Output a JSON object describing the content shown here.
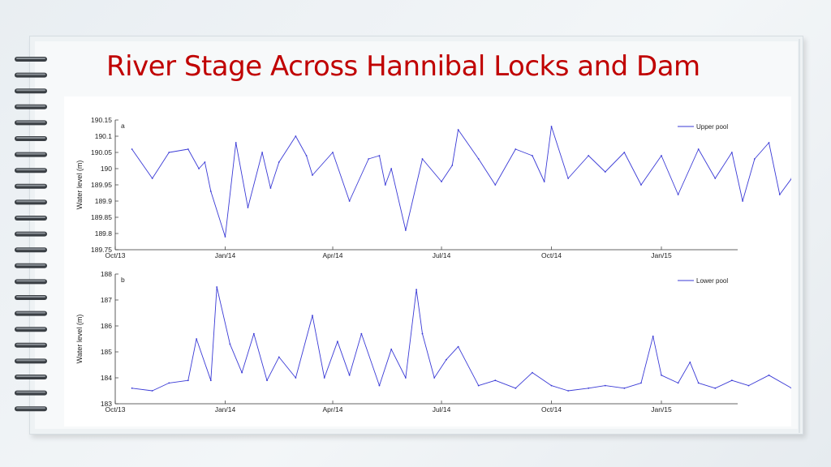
{
  "slide": {
    "title": "River Stage Across Hannibal Locks and Dam"
  },
  "colors": {
    "title": "#c00000",
    "series": "#3a3ad6",
    "axis": "#333333"
  },
  "chart_data": [
    {
      "type": "line",
      "panel_label": "a",
      "ylabel": "Water level (m)",
      "xlabel": "",
      "x_ticks": [
        "Oct/13",
        "Jan/14",
        "Apr/14",
        "Jul/14",
        "Oct/14",
        "Jan/15"
      ],
      "ylim": [
        189.75,
        190.15
      ],
      "y_ticks": [
        "189.75",
        "189.8",
        "189.85",
        "189.9",
        "189.95",
        "190",
        "190.05",
        "190.1",
        "190.15"
      ],
      "legend_position": "top-right",
      "grid": false,
      "series": [
        {
          "name": "Upper pool",
          "x": [
            "2013-10-15",
            "2013-11-01",
            "2013-11-15",
            "2013-12-01",
            "2013-12-10",
            "2013-12-15",
            "2013-12-20",
            "2014-01-01",
            "2014-01-10",
            "2014-01-20",
            "2014-02-01",
            "2014-02-08",
            "2014-02-15",
            "2014-03-01",
            "2014-03-10",
            "2014-03-15",
            "2014-04-01",
            "2014-04-15",
            "2014-05-01",
            "2014-05-10",
            "2014-05-15",
            "2014-05-20",
            "2014-06-01",
            "2014-06-15",
            "2014-07-01",
            "2014-07-10",
            "2014-07-15",
            "2014-08-01",
            "2014-08-15",
            "2014-09-01",
            "2014-09-15",
            "2014-09-25",
            "2014-10-01",
            "2014-10-15",
            "2014-11-01",
            "2014-11-15",
            "2014-12-01",
            "2014-12-15",
            "2015-01-01",
            "2015-01-15",
            "2015-02-01",
            "2015-02-15",
            "2015-03-01",
            "2015-03-10",
            "2015-03-20",
            "2015-04-01",
            "2015-04-10",
            "2015-04-20"
          ],
          "values": [
            190.06,
            189.97,
            190.05,
            190.06,
            190.0,
            190.02,
            189.93,
            189.79,
            190.08,
            189.88,
            190.05,
            189.94,
            190.02,
            190.1,
            190.04,
            189.98,
            190.05,
            189.9,
            190.03,
            190.04,
            189.95,
            190.0,
            189.81,
            190.03,
            189.96,
            190.01,
            190.12,
            190.03,
            189.95,
            190.06,
            190.04,
            189.96,
            190.13,
            189.97,
            190.04,
            189.99,
            190.05,
            189.95,
            190.04,
            189.92,
            190.06,
            189.97,
            190.05,
            189.9,
            190.03,
            190.08,
            189.92,
            189.97
          ]
        }
      ]
    },
    {
      "type": "line",
      "panel_label": "b",
      "ylabel": "Water level (m)",
      "xlabel": "",
      "x_ticks": [
        "Oct/13",
        "Jan/14",
        "Apr/14",
        "Jul/14",
        "Oct/14",
        "Jan/15"
      ],
      "ylim": [
        183,
        188
      ],
      "y_ticks": [
        "183",
        "184",
        "185",
        "186",
        "187",
        "188"
      ],
      "legend_position": "top-right",
      "grid": false,
      "series": [
        {
          "name": "Lower pool",
          "x": [
            "2013-10-15",
            "2013-11-01",
            "2013-11-15",
            "2013-12-01",
            "2013-12-08",
            "2013-12-20",
            "2013-12-25",
            "2014-01-05",
            "2014-01-15",
            "2014-01-25",
            "2014-02-05",
            "2014-02-15",
            "2014-03-01",
            "2014-03-15",
            "2014-03-25",
            "2014-04-05",
            "2014-04-15",
            "2014-04-25",
            "2014-05-10",
            "2014-05-20",
            "2014-06-01",
            "2014-06-10",
            "2014-06-15",
            "2014-06-25",
            "2014-07-05",
            "2014-07-15",
            "2014-08-01",
            "2014-08-15",
            "2014-09-01",
            "2014-09-15",
            "2014-10-01",
            "2014-10-15",
            "2014-11-01",
            "2014-11-15",
            "2014-12-01",
            "2014-12-15",
            "2014-12-25",
            "2015-01-01",
            "2015-01-15",
            "2015-01-25",
            "2015-02-01",
            "2015-02-15",
            "2015-03-01",
            "2015-03-15",
            "2015-04-01",
            "2015-04-20"
          ],
          "values": [
            183.6,
            183.5,
            183.8,
            183.9,
            185.5,
            183.9,
            187.5,
            185.3,
            184.2,
            185.7,
            183.9,
            184.8,
            184.0,
            186.4,
            184.0,
            185.4,
            184.1,
            185.7,
            183.7,
            185.1,
            184.0,
            187.4,
            185.7,
            184.0,
            184.7,
            185.2,
            183.7,
            183.9,
            183.6,
            184.2,
            183.7,
            183.5,
            183.6,
            183.7,
            183.6,
            183.8,
            185.6,
            184.1,
            183.8,
            184.6,
            183.8,
            183.6,
            183.9,
            183.7,
            184.1,
            183.6
          ]
        }
      ]
    }
  ]
}
